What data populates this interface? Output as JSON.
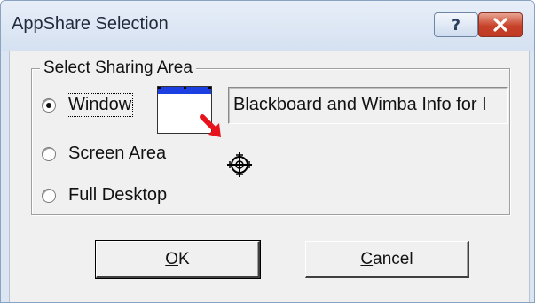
{
  "window": {
    "title": "AppShare Selection",
    "help_button": "?",
    "close_button": "✕"
  },
  "group": {
    "label": "Select Sharing Area",
    "options": [
      {
        "label": "Window",
        "checked": true
      },
      {
        "label": "Screen Area",
        "checked": false
      },
      {
        "label": "Full Desktop",
        "checked": false
      }
    ],
    "window_title_value": "Blackboard and Wimba Info for I"
  },
  "buttons": {
    "ok_label": "OK",
    "ok_mnemonic": "O",
    "ok_rest": "K",
    "cancel_label": "Cancel",
    "cancel_mnemonic": "C",
    "cancel_rest": "ancel"
  },
  "icons": {
    "help": "question-mark-icon",
    "close": "close-icon",
    "arrow": "red-arrow-icon",
    "crosshair": "window-picker-crosshair-icon"
  },
  "colors": {
    "title_bar": "#d5e1f1",
    "close_button": "#c8422a",
    "thumbnail_bar": "#1b3fe0",
    "arrow": "#e8121c"
  }
}
